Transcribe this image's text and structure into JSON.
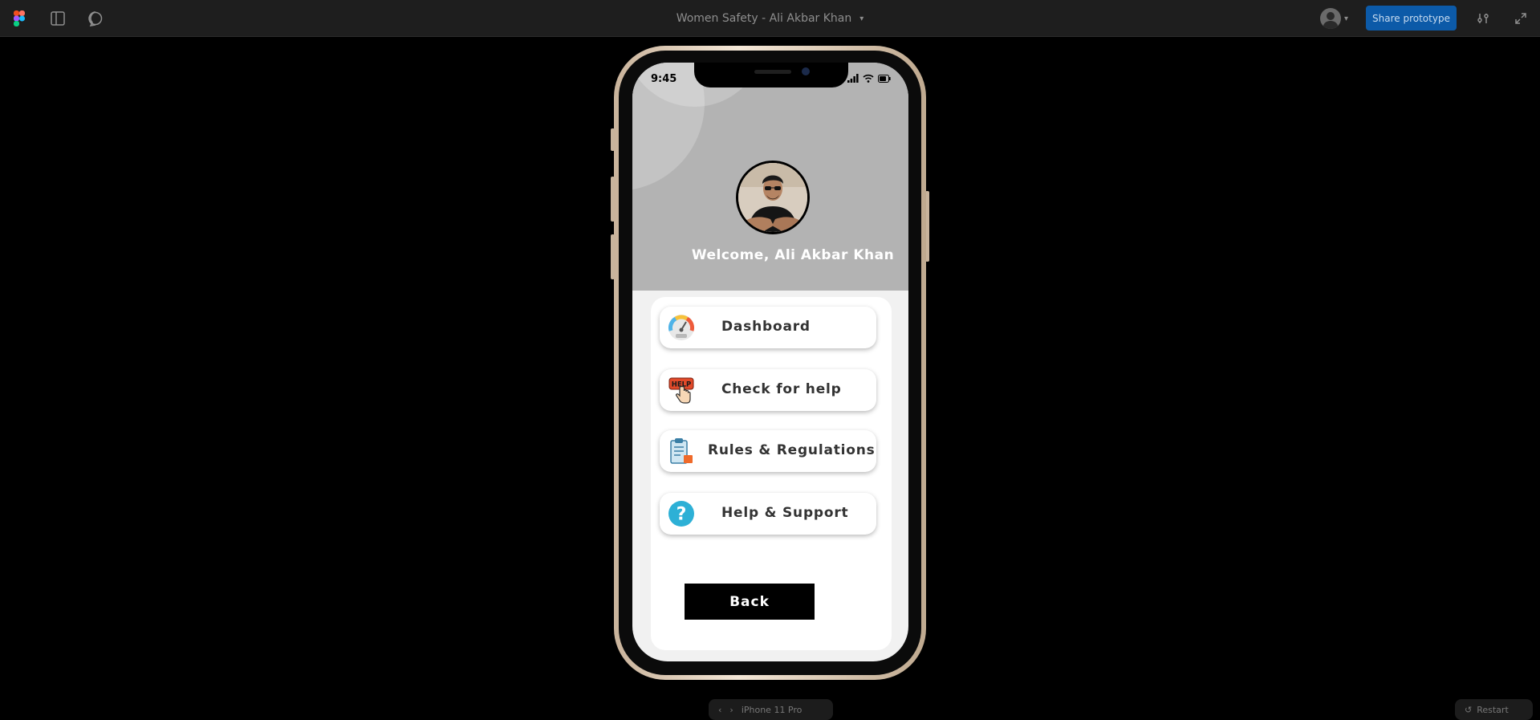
{
  "toolbar": {
    "file_title": "Women Safety - Ali Akbar Khan",
    "share_label": "Share prototype",
    "icons": [
      "figma-logo-icon",
      "sidebar-icon",
      "comment-icon",
      "settings-icon",
      "fullscreen-icon"
    ]
  },
  "phone": {
    "status_time": "9:45",
    "welcome_text": "Welcome, Ali Akbar Khan",
    "menu": [
      {
        "label": "Dashboard",
        "icon": "speedometer-icon"
      },
      {
        "label": "Check for help",
        "icon": "help-hand-icon"
      },
      {
        "label": "Rules & Regulations",
        "icon": "clipboard-icon"
      },
      {
        "label": "Help & Support",
        "icon": "question-icon"
      }
    ],
    "back_label": "Back",
    "help_badge_text": "HELP"
  },
  "bottom_bar": {
    "device_label": "iPhone 11 Pro",
    "restart_label": "Restart"
  },
  "colors": {
    "header_gray": "#b3b3b3",
    "share_blue": "#0c5aa8",
    "question_teal": "#2db0d6"
  }
}
